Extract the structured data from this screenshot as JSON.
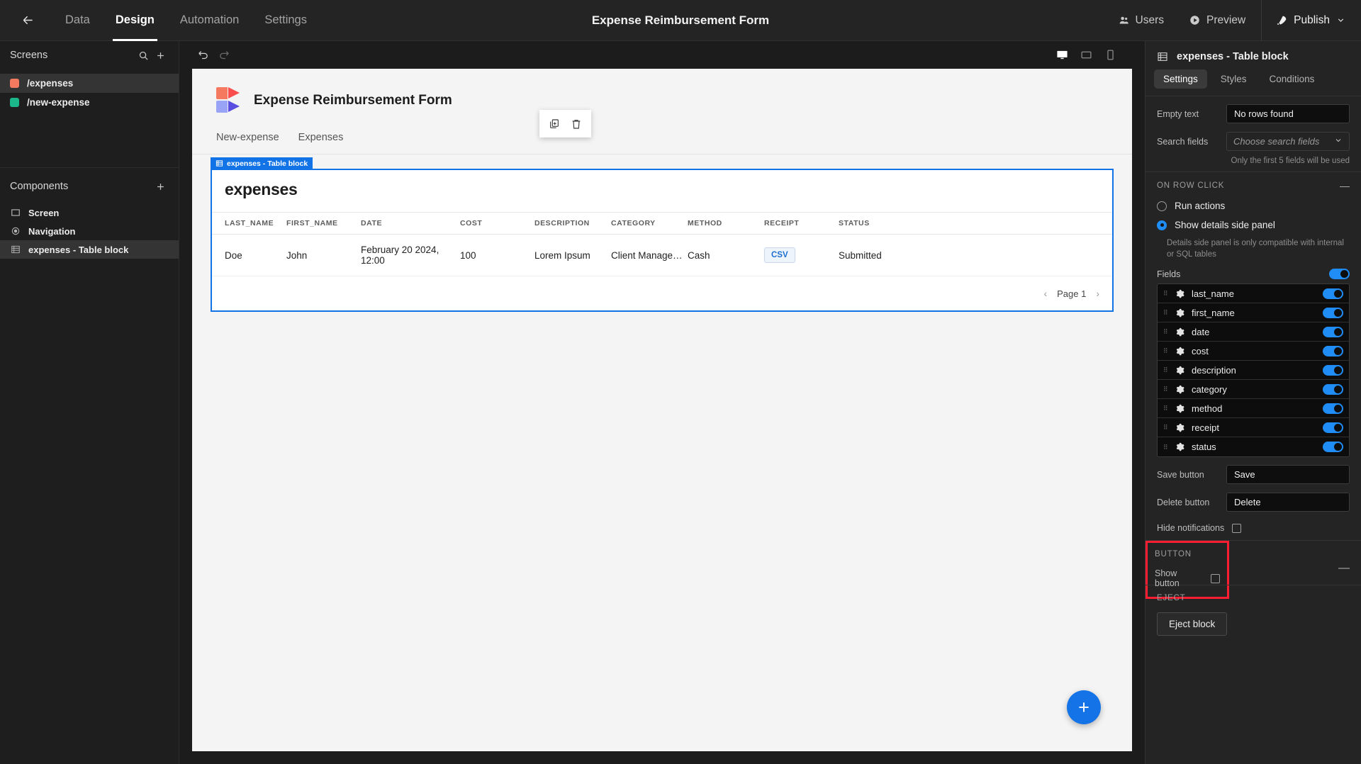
{
  "topbar": {
    "back_icon": "arrow-left-icon",
    "tabs": [
      {
        "label": "Data",
        "active": false
      },
      {
        "label": "Design",
        "active": true
      },
      {
        "label": "Automation",
        "active": false
      },
      {
        "label": "Settings",
        "active": false
      }
    ],
    "title": "Expense Reimbursement Form",
    "users_label": "Users",
    "preview_label": "Preview",
    "publish_label": "Publish"
  },
  "sidebar": {
    "screens_title": "Screens",
    "screens": [
      {
        "label": "/expenses",
        "color": "#f3795f",
        "selected": true
      },
      {
        "label": "/new-expense",
        "color": "#1bb68a",
        "selected": false
      }
    ],
    "components_title": "Components",
    "components": [
      {
        "label": "Screen",
        "icon": "screen-icon",
        "selected": false
      },
      {
        "label": "Navigation",
        "icon": "navigation-icon",
        "selected": false
      },
      {
        "label": "expenses - Table block",
        "icon": "table-icon",
        "selected": true
      }
    ]
  },
  "canvas": {
    "undo_icon": "undo-icon",
    "redo_icon": "redo-icon",
    "devices": [
      {
        "name": "desktop",
        "active": true
      },
      {
        "name": "tablet",
        "active": false
      },
      {
        "name": "mobile",
        "active": false
      }
    ],
    "app_name": "Expense Reimbursement Form",
    "page_nav": [
      "New-expense",
      "Expenses"
    ],
    "float_tools": [
      "duplicate-icon",
      "delete-icon"
    ],
    "block_tag": "expenses - Table block",
    "table": {
      "title": "expenses",
      "columns": [
        "LAST_NAME",
        "FIRST_NAME",
        "DATE",
        "COST",
        "DESCRIPTION",
        "CATEGORY",
        "METHOD",
        "RECEIPT",
        "STATUS"
      ],
      "rows": [
        {
          "last_name": "Doe",
          "first_name": "John",
          "date": "February 20 2024, 12:00",
          "cost": "100",
          "description": "Lorem Ipsum",
          "category": "Client Manage…",
          "method": "Cash",
          "receipt": "CSV",
          "status": "Submitted"
        }
      ],
      "page_label": "Page 1",
      "prev_icon": "chevron-left-icon",
      "next_icon": "chevron-right-icon"
    },
    "fab_label": "+"
  },
  "right_panel": {
    "header_title": "expenses - Table block",
    "header_icon": "table-icon",
    "tabs": [
      {
        "label": "Settings",
        "active": true
      },
      {
        "label": "Styles",
        "active": false
      },
      {
        "label": "Conditions",
        "active": false
      }
    ],
    "empty_text_label": "Empty text",
    "empty_text_value": "No rows found",
    "search_fields_label": "Search fields",
    "search_fields_placeholder": "Choose search fields",
    "search_hint": "Only the first 5 fields will be used",
    "on_row_click_title": "ON ROW CLICK",
    "on_row_click_options": [
      {
        "label": "Run actions",
        "selected": false
      },
      {
        "label": "Show details side panel",
        "selected": true
      }
    ],
    "on_row_click_note": "Details side panel is only compatible with internal or SQL tables",
    "fields_label": "Fields",
    "fields": [
      {
        "name": "last_name",
        "enabled": true
      },
      {
        "name": "first_name",
        "enabled": true
      },
      {
        "name": "date",
        "enabled": true
      },
      {
        "name": "cost",
        "enabled": true
      },
      {
        "name": "description",
        "enabled": true
      },
      {
        "name": "category",
        "enabled": true
      },
      {
        "name": "method",
        "enabled": true
      },
      {
        "name": "receipt",
        "enabled": true
      },
      {
        "name": "status",
        "enabled": true
      }
    ],
    "save_button_label": "Save button",
    "save_button_value": "Save",
    "delete_button_label": "Delete button",
    "delete_button_value": "Delete",
    "hide_notifications_label": "Hide notifications",
    "button_section_title": "BUTTON",
    "show_button_label": "Show button",
    "eject_section_title": "EJECT",
    "eject_button_label": "Eject block"
  },
  "colors": {
    "accent": "#1273e6",
    "highlight": "#ff1e32",
    "toggle_on": "#1f8df5"
  }
}
